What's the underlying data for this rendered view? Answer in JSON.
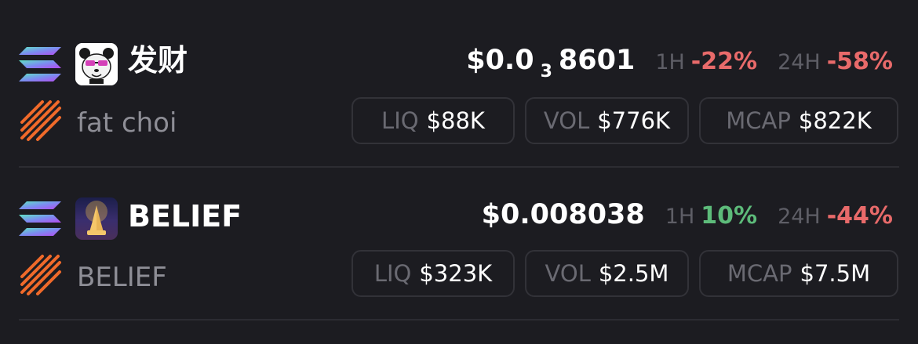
{
  "tokens": [
    {
      "name": "发财",
      "subname": "fat choi",
      "price_prefix": "$0.0",
      "price_zeros": "3",
      "price_digits": "8601",
      "tf1_label": "1H",
      "tf1_value": "-22%",
      "tf2_label": "24H",
      "tf2_value": "-58%",
      "liq_label": "LIQ",
      "liq_value": "$88K",
      "vol_label": "VOL",
      "vol_value": "$776K",
      "mcap_label": "MCAP",
      "mcap_value": "$822K",
      "avatar_icon": "panda-sunglasses-icon",
      "chain_icon": "solana-icon",
      "dex_icon": "pump-dex-icon"
    },
    {
      "name": "BELIEF",
      "subname": "BELIEF",
      "price": "$0.008038",
      "tf1_label": "1H",
      "tf1_value": "10%",
      "tf2_label": "24H",
      "tf2_value": "-44%",
      "liq_label": "LIQ",
      "liq_value": "$323K",
      "vol_label": "VOL",
      "vol_value": "$2.5M",
      "mcap_label": "MCAP",
      "mcap_value": "$7.5M",
      "avatar_icon": "praying-hands-icon",
      "chain_icon": "solana-icon",
      "dex_icon": "pump-dex-icon"
    }
  ],
  "colors": {
    "background": "#1c1c21",
    "negative": "#e86a6a",
    "positive": "#5dbb7a",
    "muted": "#6a6a72",
    "dex_orange": "#f06a2a"
  }
}
